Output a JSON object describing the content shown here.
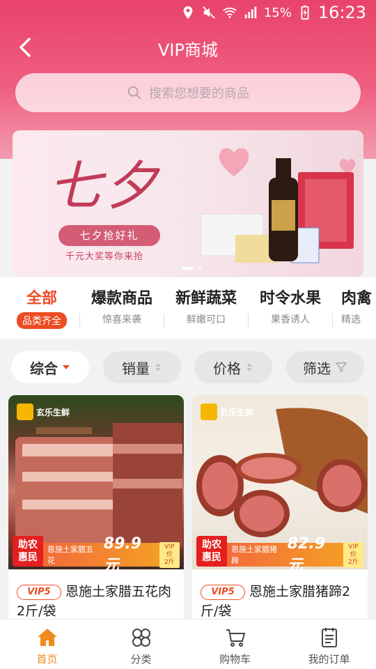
{
  "status": {
    "battery": "15%",
    "time": "16:23"
  },
  "header": {
    "title": "VIP商城",
    "search_placeholder": "搜索您想要的商品"
  },
  "banner": {
    "headline": "七夕",
    "pill": "七夕抢好礼",
    "subline": "千元大奖等你来抢"
  },
  "categories": [
    {
      "title": "全部",
      "sub": "品类齐全",
      "active": true
    },
    {
      "title": "爆款商品",
      "sub": "惊喜来袭"
    },
    {
      "title": "新鲜蔬菜",
      "sub": "鲜嫩可口"
    },
    {
      "title": "时令水果",
      "sub": "果香诱人"
    },
    {
      "title": "肉禽",
      "sub": "精选"
    }
  ],
  "sort": [
    {
      "label": "综合",
      "active": true
    },
    {
      "label": "销量"
    },
    {
      "label": "价格"
    },
    {
      "label": "筛选"
    }
  ],
  "products": [
    {
      "brand": "玄乐生鲜",
      "tag_line1": "助农",
      "tag_line2": "惠民",
      "promo_name": "恩施土家腊五花",
      "price": "89.9元",
      "price_unit": "2斤",
      "vip_price_label": "VIP价",
      "vip_badge": "VIP5",
      "title": "恩施土家腊五花肉2斤/袋"
    },
    {
      "brand": "玄乐生鲜",
      "tag_line1": "助农",
      "tag_line2": "惠民",
      "promo_name": "恩施土家腊猪蹄",
      "price": "82.9元",
      "price_unit": "2斤",
      "vip_price_label": "VIP价",
      "vip_badge": "VIP5",
      "title": "恩施土家腊猪蹄2斤/袋"
    }
  ],
  "nav": [
    {
      "label": "首页",
      "icon": "home-icon",
      "active": true
    },
    {
      "label": "分类",
      "icon": "category-grid-icon"
    },
    {
      "label": "购物车",
      "icon": "cart-icon"
    },
    {
      "label": "我的订单",
      "icon": "order-list-icon"
    }
  ],
  "colors": {
    "header_top": "#e9436a",
    "accent_orange": "#ec4c22",
    "nav_active": "#f18a1e",
    "promo_red": "#e51f1f"
  }
}
